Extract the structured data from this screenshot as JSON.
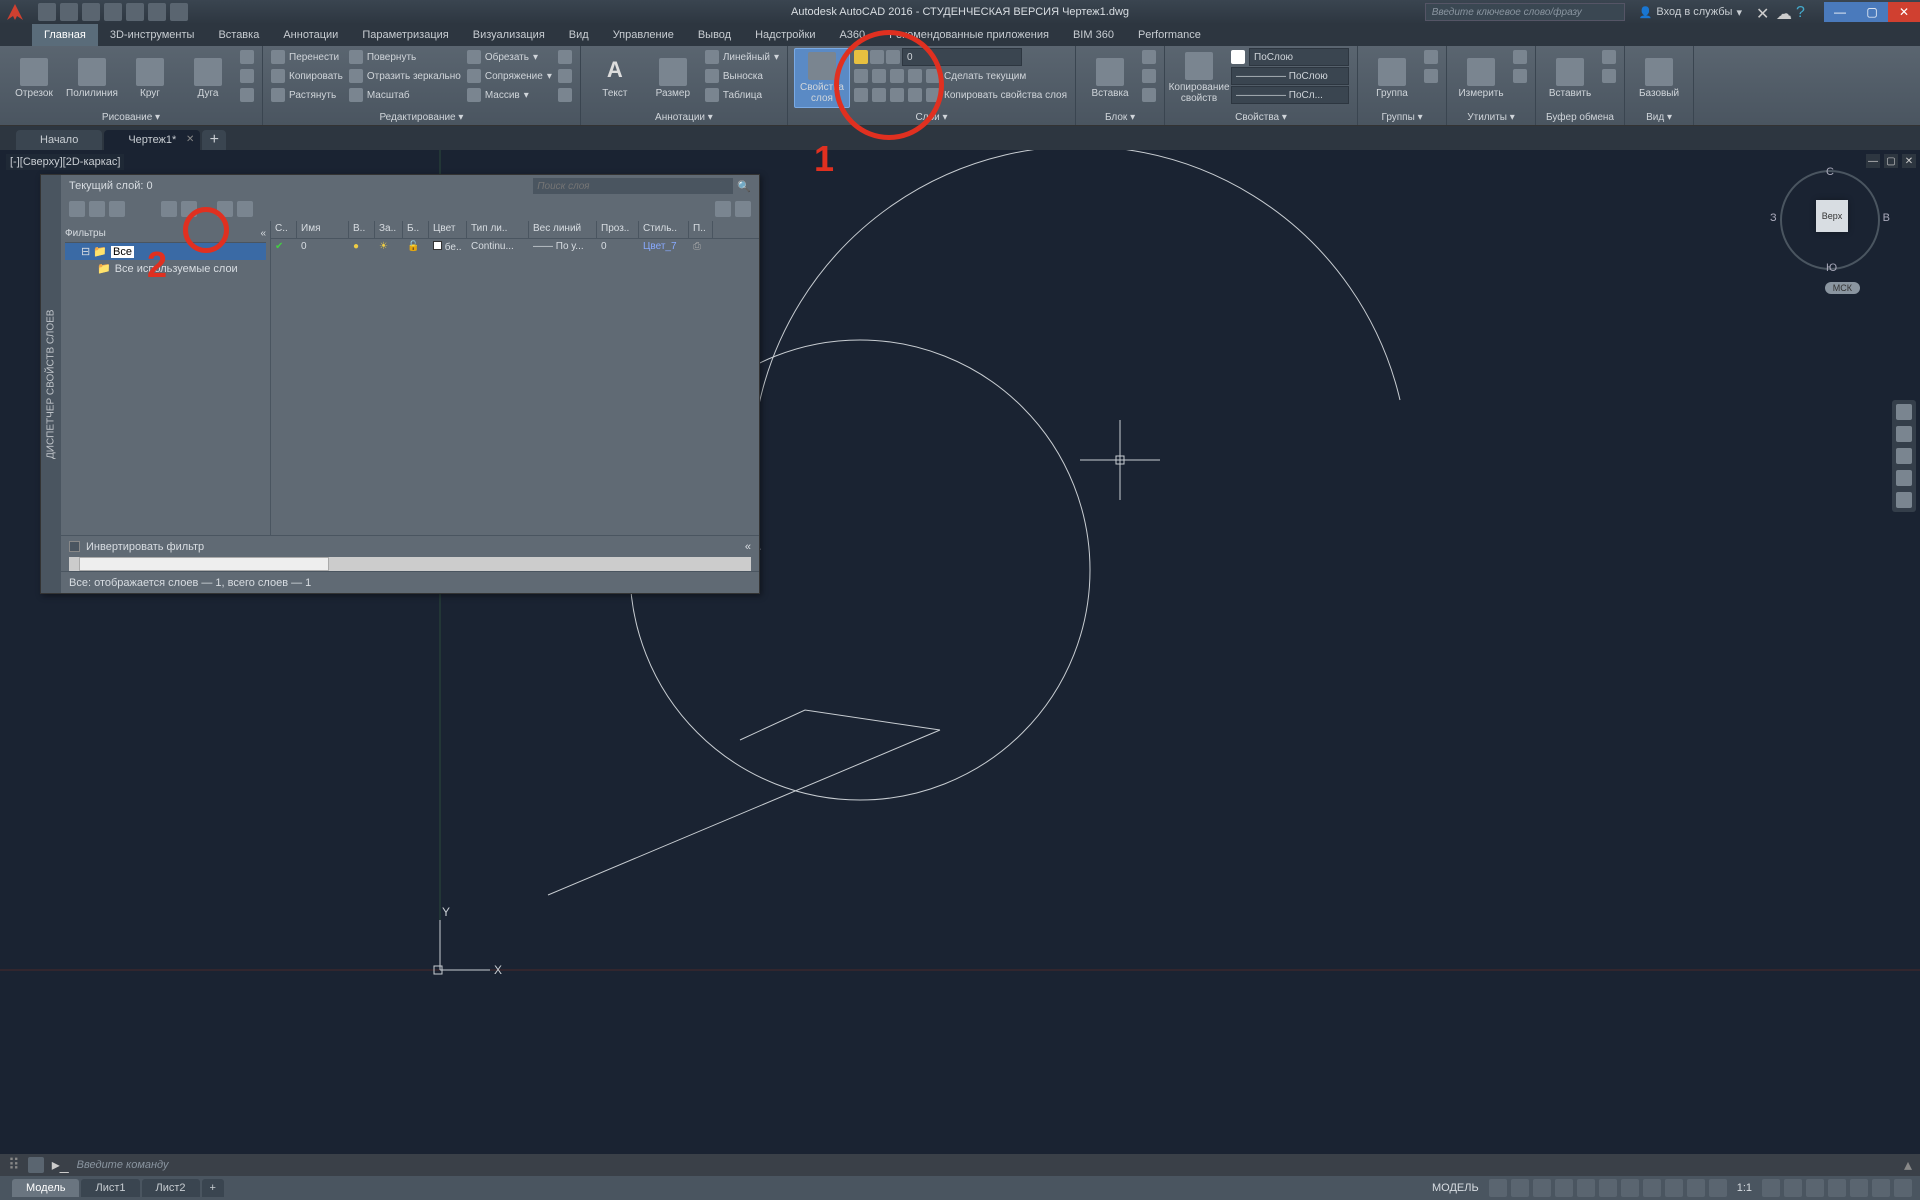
{
  "title": "Autodesk AutoCAD 2016 - СТУДЕНЧЕСКАЯ ВЕРСИЯ   Чертеж1.dwg",
  "search_placeholder": "Введите ключевое слово/фразу",
  "signin": "Вход в службы",
  "menu": [
    "Главная",
    "3D-инструменты",
    "Вставка",
    "Аннотации",
    "Параметризация",
    "Визуализация",
    "Вид",
    "Управление",
    "Вывод",
    "Надстройки",
    "A360",
    "Рекомендованные приложения",
    "BIM 360",
    "Performance"
  ],
  "panels": {
    "draw": {
      "label": "Рисование ▾",
      "items": [
        "Отрезок",
        "Полилиния",
        "Круг",
        "Дуга"
      ]
    },
    "modify": {
      "label": "Редактирование ▾",
      "rows": [
        [
          "Перенести",
          "Повернуть",
          "Обрезать"
        ],
        [
          "Копировать",
          "Отразить зеркально",
          "Сопряжение"
        ],
        [
          "Растянуть",
          "Масштаб",
          "Массив"
        ]
      ]
    },
    "anno": {
      "label": "Аннотации ▾",
      "text": "Текст",
      "dim": "Размер",
      "rows": [
        "Линейный",
        "Выноска",
        "Таблица"
      ]
    },
    "layers": {
      "label": "Слои ▾",
      "big": "Свойства слоя",
      "current": "0",
      "rows": [
        "Сделать текущим",
        "Копировать свойства слоя"
      ]
    },
    "block": {
      "label": "Блок ▾",
      "insert": "Вставка"
    },
    "props": {
      "label": "Свойства ▾",
      "copyprops": "Копирование свойств",
      "bylayer": "ПоСлою",
      "line1": "————— ПоСлою",
      "line2": "————— ПоСл..."
    },
    "groups": {
      "label": "Группы ▾",
      "g": "Группа"
    },
    "utils": {
      "label": "Утилиты ▾",
      "m": "Измерить"
    },
    "clip": {
      "label": "Буфер обмена",
      "p": "Вставить"
    },
    "view": {
      "label": "Вид ▾",
      "b": "Базовый"
    }
  },
  "drawtabs": {
    "start": "Начало",
    "file": "Чертеж1*",
    "plus": "+"
  },
  "viewport_label": "[-][Сверху][2D-каркас]",
  "axes": {
    "x": "X",
    "y": "Y"
  },
  "layerpanel": {
    "sidebar": "ДИСПЕТЧЕР СВОЙСТВ СЛОЕВ",
    "title": "Текущий слой: 0",
    "search": "Поиск слоя",
    "filters": "Фильтры",
    "tree": [
      "Все",
      "Все используемые слои"
    ],
    "cols": [
      "С..",
      "Имя",
      "В..",
      "За..",
      "Б..",
      "Цвет",
      "Тип ли..",
      "Вес линий",
      "Проз..",
      "Стиль..",
      "П.."
    ],
    "row": {
      "name": "0",
      "color": "бе..",
      "lt": "Continu...",
      "lw": "—— По у...",
      "tr": "0",
      "ps": "Цвет_7"
    },
    "invert": "Инвертировать фильтр",
    "status": "Все: отображается слоев — 1, всего слоев — 1"
  },
  "viewcube": {
    "top": "Верх",
    "n": "С",
    "s": "Ю",
    "e": "В",
    "w": "З",
    "wcs": "МСК"
  },
  "cmdline": "Введите  команду",
  "layouts": [
    "Модель",
    "Лист1",
    "Лист2"
  ],
  "status": {
    "model": "МОДЕЛЬ",
    "scale": "1:1"
  },
  "anno": {
    "n1": "1",
    "n2": "2"
  }
}
